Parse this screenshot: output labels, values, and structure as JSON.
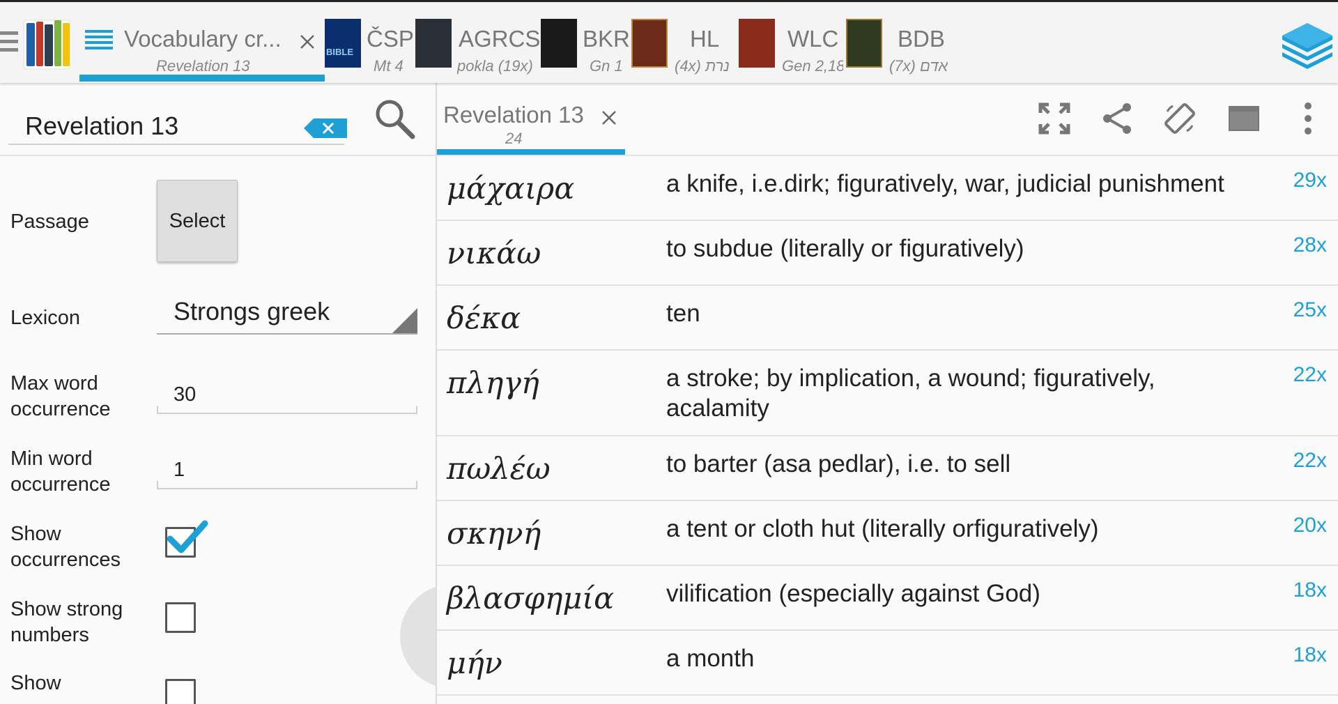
{
  "top_tabs": {
    "active": {
      "title": "Vocabulary cr...",
      "sub": "Revelation 13"
    },
    "docs": [
      {
        "abbr": "ČSP",
        "sub": "Mt 4",
        "cover_color": "#0b2f6e",
        "cover_text": "BIBLE"
      },
      {
        "abbr": "AGRCS",
        "sub": "pokla (19x)",
        "cover_color": "#2a2f38",
        "cover_text": ""
      },
      {
        "abbr": "BKR",
        "sub": "Gn 1",
        "cover_color": "#1a1a1a",
        "cover_text": ""
      },
      {
        "abbr": "HL",
        "sub": "(4x) נרת",
        "cover_color": "#6b2a1a",
        "cover_text": ""
      },
      {
        "abbr": "WLC",
        "sub": "Gen 2,18",
        "cover_color": "#8a2c1c",
        "cover_text": ""
      },
      {
        "abbr": "BDB",
        "sub": "(7x) אדם",
        "cover_color": "#2e3a20",
        "cover_text": ""
      }
    ]
  },
  "left": {
    "search_value": "Revelation 13",
    "passage_label": "Passage",
    "select_button": "Select",
    "lexicon_label": "Lexicon",
    "lexicon_value": "Strongs greek",
    "max_label": "Max word occurrence",
    "max_value": "30",
    "min_label": "Min word occurrence",
    "min_value": "1",
    "show_occ_label": "Show occurrences",
    "show_occ_checked": true,
    "show_strong_label": "Show strong numbers",
    "show_strong_checked": false,
    "show_last_label": "Show"
  },
  "right": {
    "tab_title": "Revelation 13",
    "tab_sub": "24",
    "words": [
      {
        "greek": "μάχαιρα",
        "def": "a knife, i.e.dirk; figuratively, war, judicial punishment",
        "count": "29x"
      },
      {
        "greek": "νικάω",
        "def": "to subdue (literally or figuratively)",
        "count": "28x"
      },
      {
        "greek": "δέκα",
        "def": "ten",
        "count": "25x"
      },
      {
        "greek": "πληγή",
        "def": "a stroke; by implication, a wound; figuratively, acalamity",
        "count": "22x"
      },
      {
        "greek": "πωλέω",
        "def": "to barter (asa pedlar), i.e. to sell",
        "count": "22x"
      },
      {
        "greek": "σκηνή",
        "def": "a tent or cloth hut (literally orfiguratively)",
        "count": "20x"
      },
      {
        "greek": "βλασφημία",
        "def": "vilification (especially against God)",
        "count": "18x"
      },
      {
        "greek": "μήν",
        "def": "a month",
        "count": "18x"
      }
    ]
  },
  "colors": {
    "accent": "#1ea0d6"
  },
  "icons": [
    "menu-icon",
    "bookshelf-logo-icon",
    "list-icon",
    "close-icon",
    "books-stack-icon",
    "clear-text-icon",
    "search-icon",
    "fullscreen-icon",
    "share-icon",
    "rotate-screen-icon",
    "window-icon",
    "more-vert-icon",
    "checkmark-icon",
    "dropdown-caret-icon"
  ]
}
